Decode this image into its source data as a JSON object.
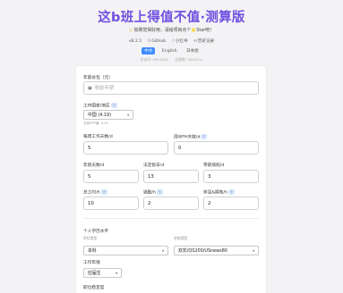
{
  "header": {
    "title": "这b班上得值不值·测算版",
    "subtitle_star": "✩",
    "subtitle": "如果觉得好用，请给项目点个⭐Star吧！",
    "links": [
      {
        "icon": "",
        "label": "v8.2.1"
      },
      {
        "icon": "G",
        "label": "GitHub"
      },
      {
        "icon": "♪",
        "label": "小红书"
      },
      {
        "icon": "⟲",
        "label": "历史记录"
      }
    ],
    "languages": [
      "中文",
      "English",
      "日本語"
    ],
    "active_language": "中文",
    "visits": [
      "总访问: 9914826",
      "访客数: 2849211"
    ]
  },
  "form": {
    "annual_salary": {
      "label": "年薪总包（元）",
      "placeholder": "税前年薪",
      "value": ""
    },
    "country": {
      "label": "工作国家/地区",
      "help": "?",
      "selected": "中国 (4.19)",
      "hint": "当前PPP值: 4.19"
    },
    "weekly_days": {
      "label": "每周工作天数/d",
      "value": "5"
    },
    "wfh_days": {
      "label": "周WFH天数/d",
      "help": "?",
      "value": "0"
    },
    "annual_leave": {
      "label": "年假天数/d",
      "value": "5"
    },
    "holidays": {
      "label": "法定假日/d",
      "value": "13"
    },
    "paid_sick": {
      "label": "带薪病假/d",
      "value": "3"
    },
    "work_hours": {
      "label": "总工时/h",
      "help": "?",
      "value": "10"
    },
    "commute": {
      "label": "通勤/h",
      "help": "?",
      "value": "2"
    },
    "rest": {
      "label": "休息&摸鱼/h",
      "help": "?",
      "value": "2"
    },
    "education_section": "个人学历水平",
    "degree_type": {
      "label": "学位类型",
      "selected": "本科"
    },
    "school_type": {
      "label": "学校类型",
      "selected": "双非/QS200/USnews80"
    },
    "work_years": {
      "label": "工作年限",
      "selected": "应届生"
    },
    "job_stability": {
      "label": "职位稳定度"
    }
  }
}
